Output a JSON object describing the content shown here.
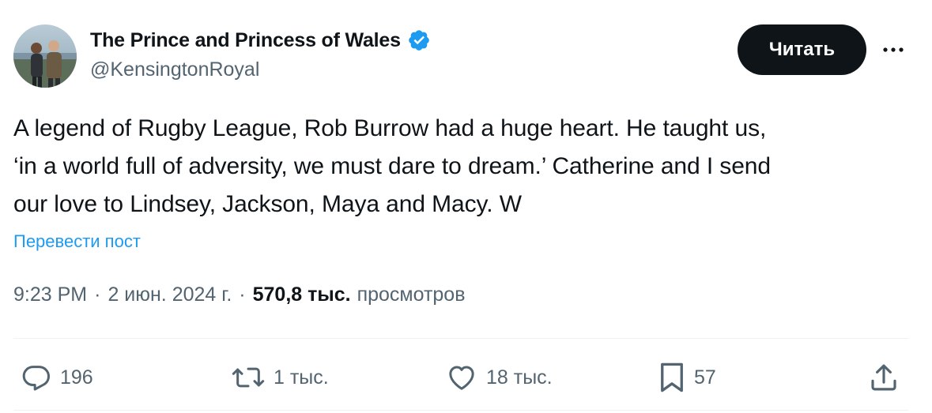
{
  "author": {
    "display_name": "The Prince and Princess of Wales",
    "handle": "@KensingtonRoyal",
    "verified": true
  },
  "follow_button_label": "Читать",
  "tweet": {
    "text": "A legend of Rugby League, Rob Burrow had a huge heart. He taught us,\n‘in a world full of adversity, we must dare to dream.’ Catherine and I send\nour love to Lindsey, Jackson, Maya and Macy. W",
    "translate_label": "Перевести пост"
  },
  "meta": {
    "time": "9:23 PM",
    "separator": "·",
    "date": "2 июн. 2024 г.",
    "views_count": "570,8 тыс.",
    "views_label": "просмотров"
  },
  "actions": {
    "replies": "196",
    "reposts": "1 тыс.",
    "likes": "18 тыс.",
    "bookmarks": "57"
  },
  "colors": {
    "primary_text": "#0f1419",
    "secondary_text": "#536471",
    "accent": "#1d9bf0",
    "divider": "#eff3f4"
  },
  "icons": {
    "verified": "verified-badge-icon",
    "more": "more-horizontal-icon",
    "reply": "reply-icon",
    "repost": "repost-icon",
    "like": "heart-icon",
    "bookmark": "bookmark-icon",
    "share": "share-icon"
  }
}
